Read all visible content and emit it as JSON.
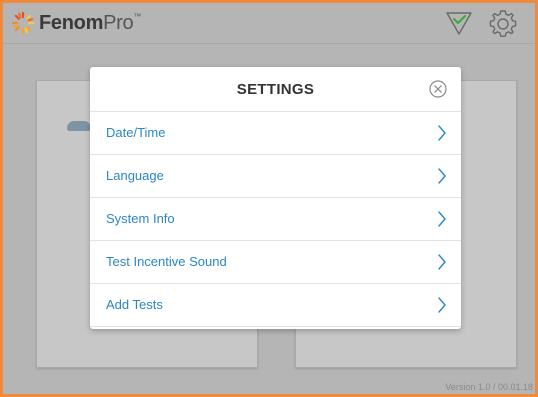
{
  "app": {
    "logo_bold": "Fenom",
    "logo_light": "Pro",
    "logo_tm": "™"
  },
  "topbar": {
    "status_icon": "check-triangle-icon",
    "settings_icon": "gear-icon"
  },
  "colors": {
    "frame": "#f08a3c",
    "accent": "#2a86c9",
    "check": "#3aaa35"
  },
  "modal": {
    "title": "SETTINGS",
    "close_icon": "close-circle-icon",
    "items": [
      {
        "label": "Date/Time"
      },
      {
        "label": "Language"
      },
      {
        "label": "System Info"
      },
      {
        "label": "Test Incentive Sound"
      },
      {
        "label": "Add Tests"
      }
    ]
  },
  "footer": {
    "version": "Version 1.0 / 00.01.18"
  }
}
